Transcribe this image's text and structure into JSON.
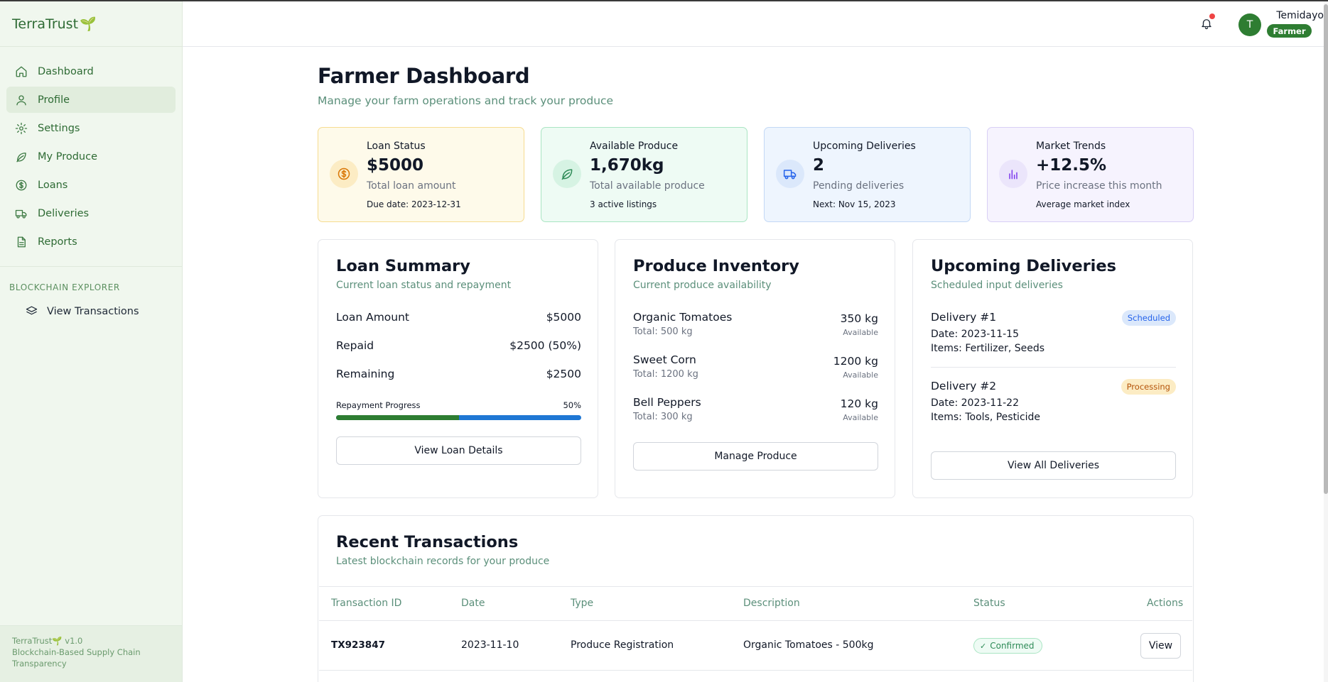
{
  "brand": {
    "name": "TerraTrust",
    "sprout": "🌱"
  },
  "sidebar": {
    "items": [
      {
        "label": "Dashboard",
        "icon": "home-icon"
      },
      {
        "label": "Profile",
        "icon": "user-icon",
        "active": true
      },
      {
        "label": "Settings",
        "icon": "gear-icon"
      },
      {
        "label": "My Produce",
        "icon": "leaf-icon"
      },
      {
        "label": "Loans",
        "icon": "dollar-circle-icon"
      },
      {
        "label": "Deliveries",
        "icon": "truck-icon"
      },
      {
        "label": "Reports",
        "icon": "document-icon"
      }
    ],
    "section_title": "BLOCKCHAIN EXPLORER",
    "explorer_item": "View Transactions",
    "footer": {
      "version": "TerraTrust🌱 v1.0",
      "tagline": "Blockchain-Based Supply Chain Transparency"
    }
  },
  "header": {
    "user_initial": "T",
    "user_name": "Temidayo",
    "user_role": "Farmer",
    "has_notification": true
  },
  "page": {
    "title": "Farmer Dashboard",
    "subtitle": "Manage your farm operations and track your produce"
  },
  "stats": {
    "loan": {
      "label": "Loan Status",
      "value": "$5000",
      "desc": "Total loan amount",
      "note": "Due date: 2023-12-31"
    },
    "produce": {
      "label": "Available Produce",
      "value": "1,670kg",
      "desc": "Total available produce",
      "note": "3 active listings"
    },
    "deliveries": {
      "label": "Upcoming Deliveries",
      "value": "2",
      "desc": "Pending deliveries",
      "note": "Next: Nov 15, 2023"
    },
    "market": {
      "label": "Market Trends",
      "value": "+12.5%",
      "desc": "Price increase this month",
      "note": "Average market index"
    }
  },
  "loan_summary": {
    "title": "Loan Summary",
    "subtitle": "Current loan status and repayment",
    "rows": [
      {
        "label": "Loan Amount",
        "value": "$5000"
      },
      {
        "label": "Repaid",
        "value": "$2500 (50%)"
      },
      {
        "label": "Remaining",
        "value": "$2500"
      }
    ],
    "progress_label": "Repayment Progress",
    "progress_text": "50%",
    "progress_fraction": 0.5,
    "button": "View Loan Details"
  },
  "inventory": {
    "title": "Produce Inventory",
    "subtitle": "Current produce availability",
    "items": [
      {
        "name": "Organic Tomatoes",
        "total": "Total: 500 kg",
        "qty": "350 kg",
        "status": "Available"
      },
      {
        "name": "Sweet Corn",
        "total": "Total: 1200 kg",
        "qty": "1200 kg",
        "status": "Available"
      },
      {
        "name": "Bell Peppers",
        "total": "Total: 300 kg",
        "qty": "120 kg",
        "status": "Available"
      }
    ],
    "button": "Manage Produce"
  },
  "deliveries": {
    "title": "Upcoming Deliveries",
    "subtitle": "Scheduled input deliveries",
    "items": [
      {
        "title": "Delivery #1",
        "badge": "Scheduled",
        "date": "Date: 2023-11-15",
        "items": "Items: Fertilizer, Seeds"
      },
      {
        "title": "Delivery #2",
        "badge": "Processing",
        "date": "Date: 2023-11-22",
        "items": "Items: Tools, Pesticide"
      }
    ],
    "button": "View All Deliveries"
  },
  "transactions": {
    "title": "Recent Transactions",
    "subtitle": "Latest blockchain records for your produce",
    "columns": [
      "Transaction ID",
      "Date",
      "Type",
      "Description",
      "Status",
      "Actions"
    ],
    "rows": [
      {
        "id": "TX923847",
        "date": "2023-11-10",
        "type": "Produce Registration",
        "description": "Organic Tomatoes - 500kg",
        "status": "Confirmed",
        "action": "View"
      }
    ]
  }
}
